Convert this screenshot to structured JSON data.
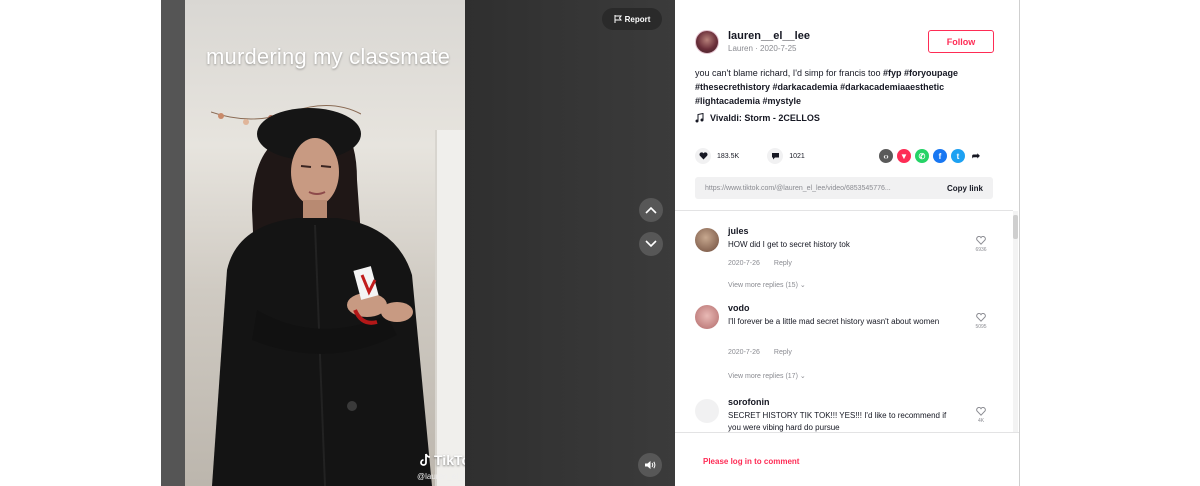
{
  "video": {
    "overlay_title": "murdering my classmate",
    "watermark": "TikTok",
    "watermark_handle": "@lauren_el_lee",
    "report_label": "Report"
  },
  "author": {
    "username": "lauren__el__lee",
    "subline": "Lauren · 2020-7-25",
    "follow_label": "Follow"
  },
  "caption": {
    "text": "you can't blame richard, I'd simp for francis too",
    "tags": "#fyp #foryoupage #thesecrethistory #darkacademia #darkacademiaaesthetic #lightacademia #mystyle"
  },
  "music": "Vivaldi: Storm - 2CELLOS",
  "stats": {
    "likes": "183.5K",
    "comments": "1021"
  },
  "share": {
    "link": "https://www.tiktok.com/@lauren_el_lee/video/6853545776...",
    "copy_label": "Copy link"
  },
  "comments": [
    {
      "name": "jules",
      "text": "HOW did I get to secret history tok",
      "date": "2020-7-26",
      "reply_label": "Reply",
      "likes": "6936",
      "view_replies": "View more replies (15)"
    },
    {
      "name": "vodo",
      "text": "I'll forever be a little mad secret history wasn't about women",
      "date": "2020-7-26",
      "reply_label": "Reply",
      "likes": "5095",
      "view_replies": "View more replies (17)"
    },
    {
      "name": "sorofonin",
      "text": "SECRET HISTORY TIK TOK!!! YES!!! I'd like to recommend if you were vibing hard do pursue",
      "likes": "4K"
    }
  ],
  "login_prompt": "Please log in to comment",
  "colors": {
    "brand_pink": "#fe2c55",
    "text_primary": "#161823",
    "text_secondary": "#8a8b91"
  }
}
